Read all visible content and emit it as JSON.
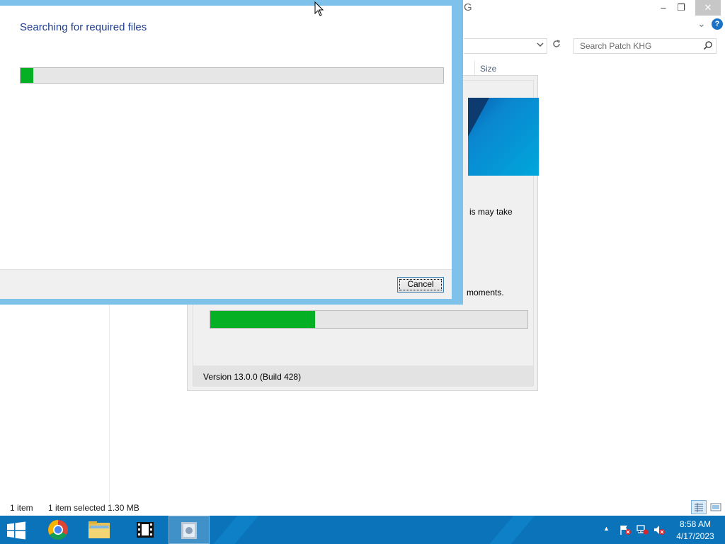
{
  "explorer": {
    "title_fragment": "G",
    "search_placeholder": "Search Patch KHG",
    "column_size": "Size",
    "status_items": "1 item",
    "status_selected": "1 item selected  1.30 MB",
    "window_buttons": {
      "minimize": "–",
      "restore": "❐",
      "close": "✕"
    },
    "expand_ribbon": "⌄",
    "help": "?"
  },
  "installer": {
    "text_line1": "is may take",
    "text_line2": "moments.",
    "progress_fraction": 0.33,
    "version": "Version 13.0.0 (Build 428)"
  },
  "dialog": {
    "title": "Searching for required files",
    "progress_fraction": 0.03,
    "cancel_label": "Cancel"
  },
  "taskbar": {
    "clock_time": "8:58 AM",
    "clock_date": "4/17/2023",
    "tray_overflow": "▲"
  },
  "colors": {
    "progress_green": "#06b025",
    "dialog_title": "#1e3d8f",
    "taskbar": "#0b73b9"
  }
}
